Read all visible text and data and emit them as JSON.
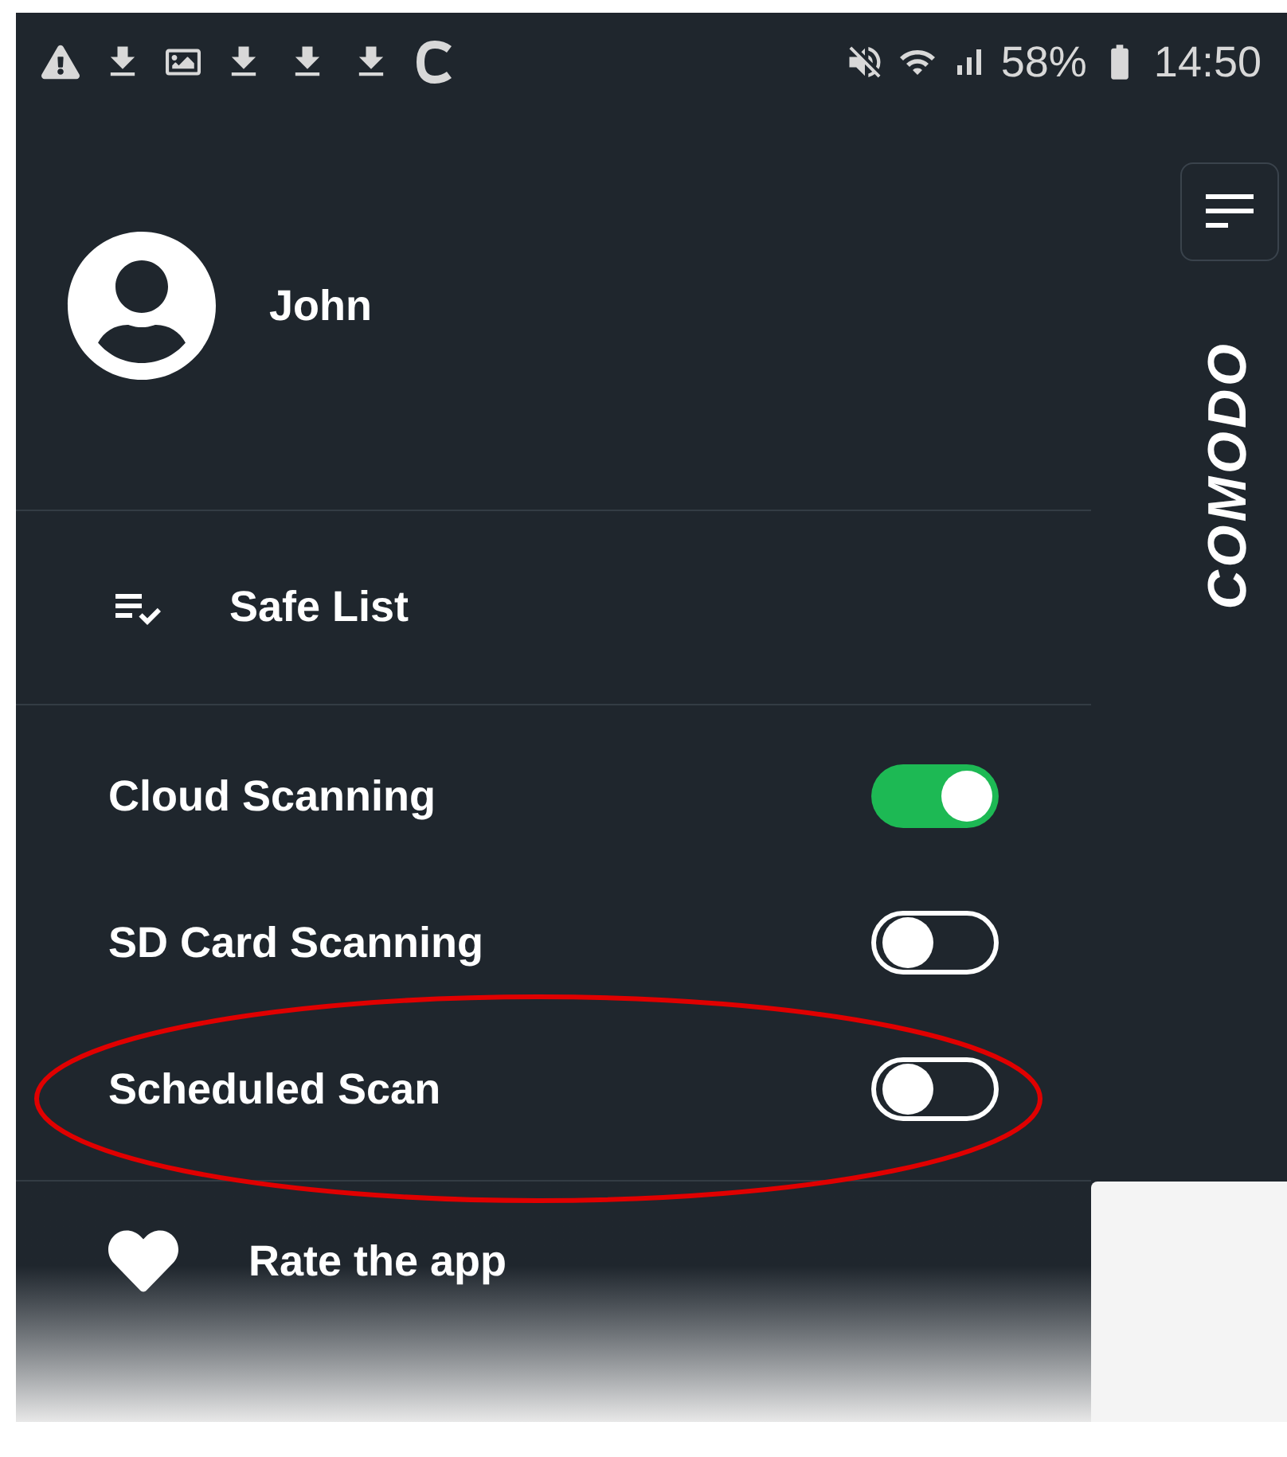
{
  "status_bar": {
    "battery": "58%",
    "time": "14:50"
  },
  "profile": {
    "name": "John"
  },
  "safe_list": {
    "label": "Safe List"
  },
  "toggles": [
    {
      "label": "Cloud Scanning",
      "on": true
    },
    {
      "label": "SD Card Scanning",
      "on": false
    },
    {
      "label": "Scheduled Scan",
      "on": false
    }
  ],
  "rate": {
    "label": "Rate the app"
  },
  "brand": "COMODO"
}
